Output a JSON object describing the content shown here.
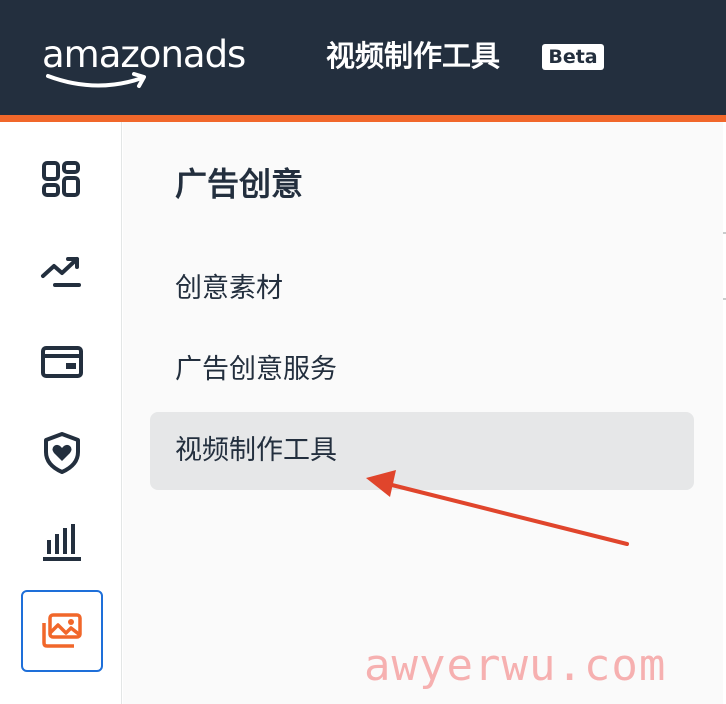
{
  "header": {
    "logo_text": "amazonads",
    "app_title": "视频制作工具",
    "beta_label": "Beta"
  },
  "rail": {
    "items": [
      {
        "icon": "dashboard-grid-icon",
        "active": false
      },
      {
        "icon": "trending-chart-icon",
        "active": false
      },
      {
        "icon": "wallet-icon",
        "active": false
      },
      {
        "icon": "shield-heart-icon",
        "active": false
      },
      {
        "icon": "bar-chart-icon",
        "active": false
      },
      {
        "icon": "image-gallery-icon",
        "active": true
      }
    ]
  },
  "panel": {
    "heading": "广告创意",
    "items": [
      {
        "label": "创意素材",
        "selected": false
      },
      {
        "label": "广告创意服务",
        "selected": false
      },
      {
        "label": "视频制作工具",
        "selected": true
      }
    ]
  },
  "watermark": "awyerwu.com",
  "colors": {
    "header_bg": "#232f3e",
    "accent": "#f1672a",
    "active_border": "#1e6fd9",
    "arrow": "#e0452c",
    "icon": "#232f3e"
  }
}
